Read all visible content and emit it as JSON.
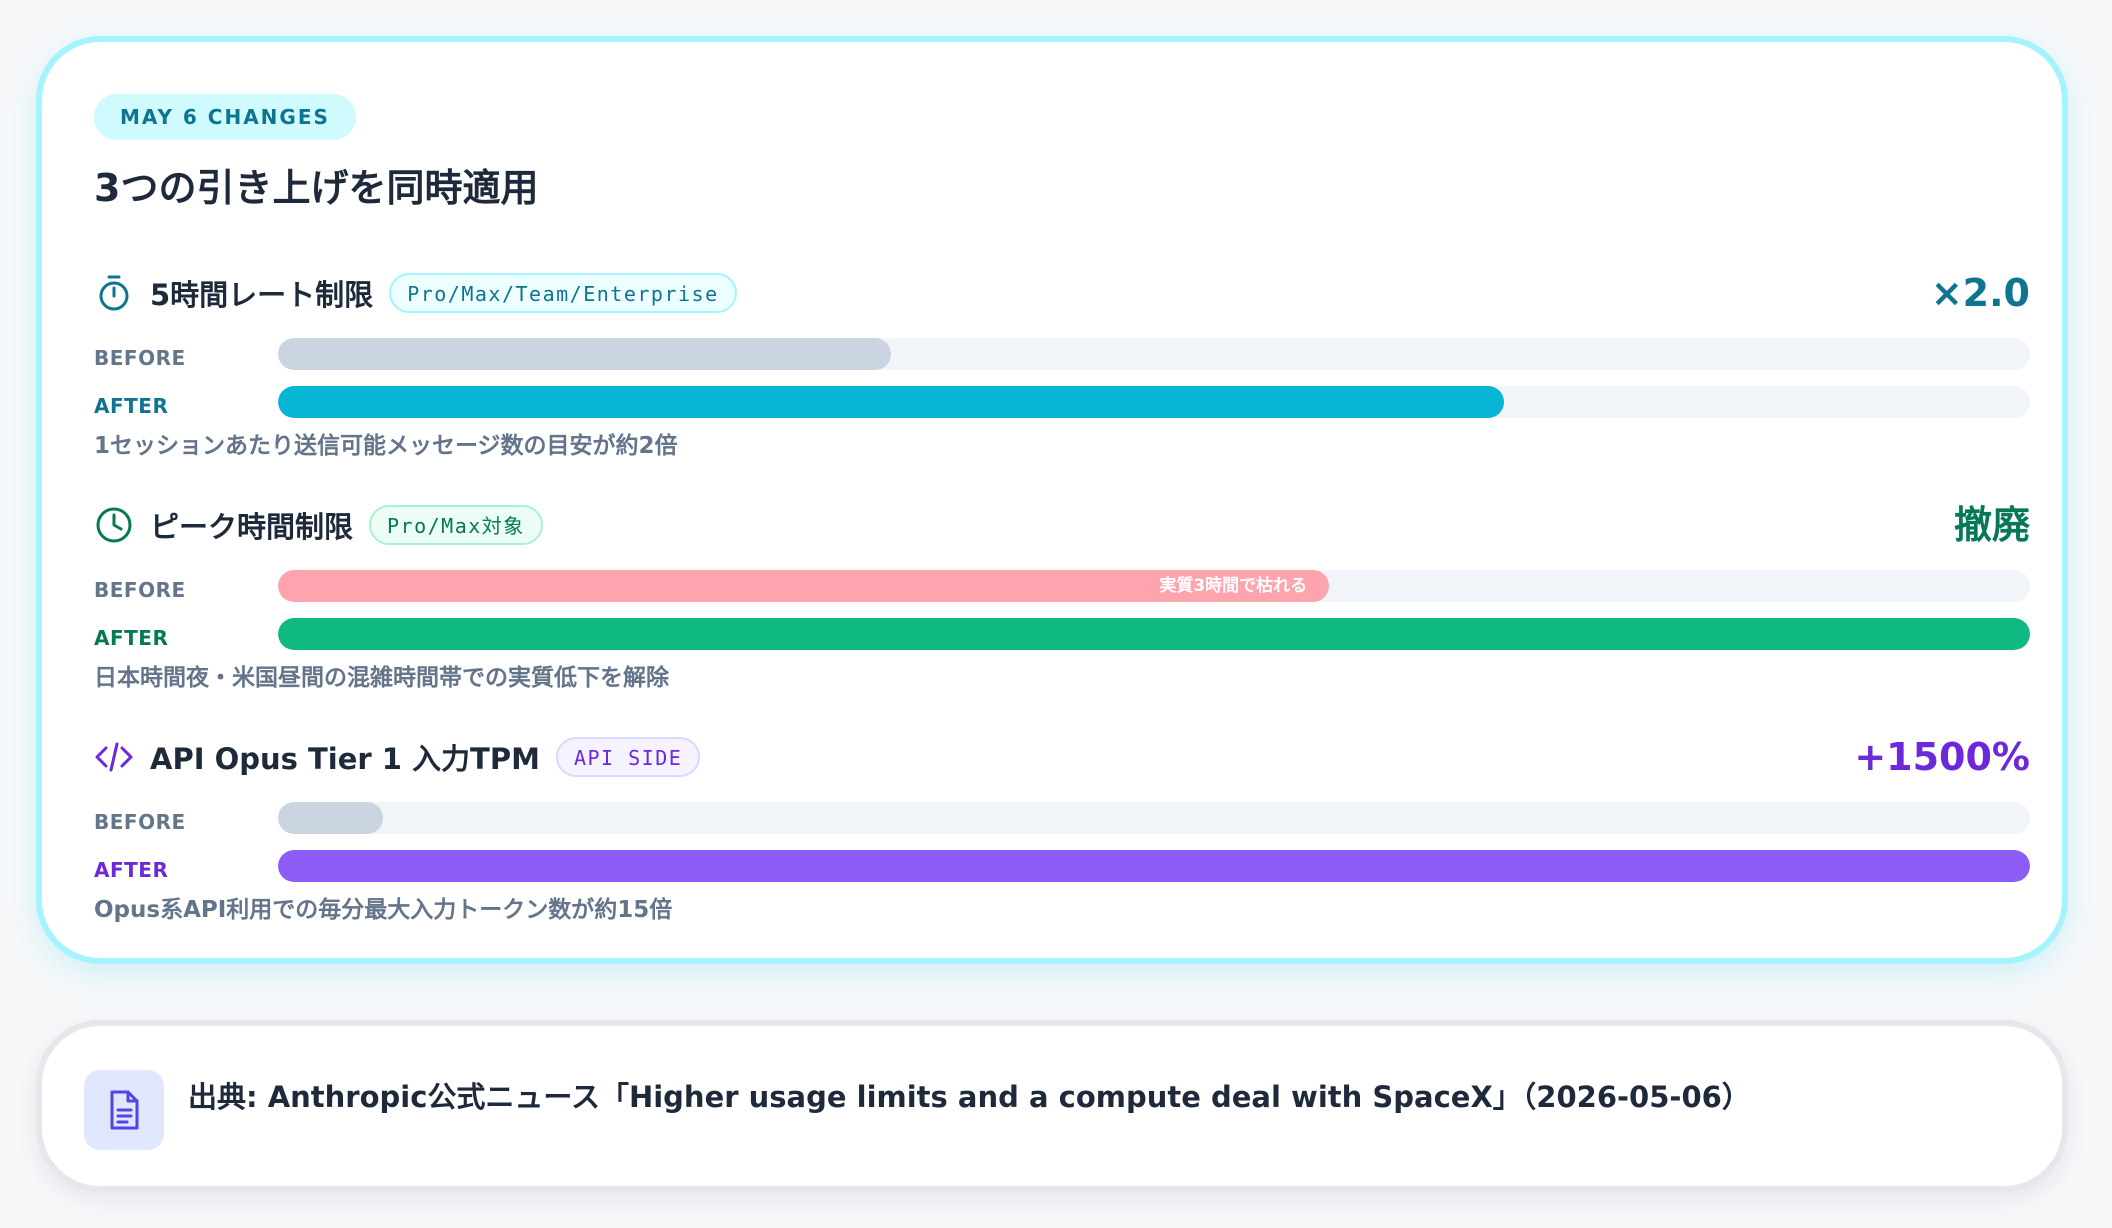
{
  "card": {
    "tag": "MAY 6 CHANGES",
    "title": "3つの引き上げを同時適用"
  },
  "sections": [
    {
      "icon": "stopwatch-icon",
      "title": "5時間レート制限",
      "badge": "Pro/Max/Team/Enterprise",
      "value": "×2.0",
      "before_label": "BEFORE",
      "after_label": "AFTER",
      "before_level": 0.35,
      "after_level": 0.7,
      "before_note": "",
      "description": "1セッションあたり送信可能メッセージ数の目安が約2倍",
      "accent_color": "#0e7490",
      "before_color": "#cbd5e1",
      "after_color": "#06b6d4"
    },
    {
      "icon": "clock-icon",
      "title": "ピーク時間制限",
      "badge": "Pro/Max対象",
      "value": "撤廃",
      "before_label": "BEFORE",
      "after_label": "AFTER",
      "before_level": 0.6,
      "after_level": 1.0,
      "before_note": "実質3時間で枯れる",
      "description": "日本時間夜・米国昼間の混雑時間帯での実質低下を解除",
      "accent_color": "#047857",
      "before_color": "#fda4af",
      "after_color": "#10b981"
    },
    {
      "icon": "code-icon",
      "title": "API Opus Tier 1 入力TPM",
      "badge": "API SIDE",
      "value": "+1500%",
      "before_label": "BEFORE",
      "after_label": "AFTER",
      "before_level": 0.06,
      "after_level": 1.0,
      "before_note": "",
      "description": "Opus系API利用での毎分最大入力トークン数が約15倍",
      "accent_color": "#6d28d9",
      "before_color": "#cbd5e1",
      "after_color": "#8b5cf6"
    }
  ],
  "source": {
    "icon": "document-icon",
    "text": "出典: Anthropic公式ニュース「Higher usage limits and a compute deal with SpaceX」（2026-05-06）"
  }
}
